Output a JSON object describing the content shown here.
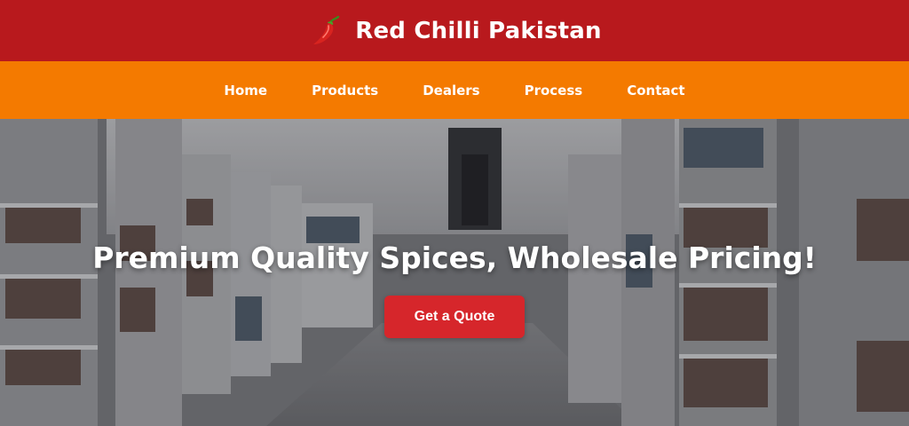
{
  "header": {
    "brand_name": "Red Chilli Pakistan",
    "logo_icon": "chili-pepper-icon",
    "background_color": "#b8191d"
  },
  "nav": {
    "background_color": "#f47a00",
    "items": [
      {
        "label": "Home"
      },
      {
        "label": "Products"
      },
      {
        "label": "Dealers"
      },
      {
        "label": "Process"
      },
      {
        "label": "Contact"
      }
    ]
  },
  "hero": {
    "title": "Premium Quality Spices, Wholesale Pricing!",
    "cta_label": "Get a Quote",
    "cta_color": "#d6262b"
  }
}
